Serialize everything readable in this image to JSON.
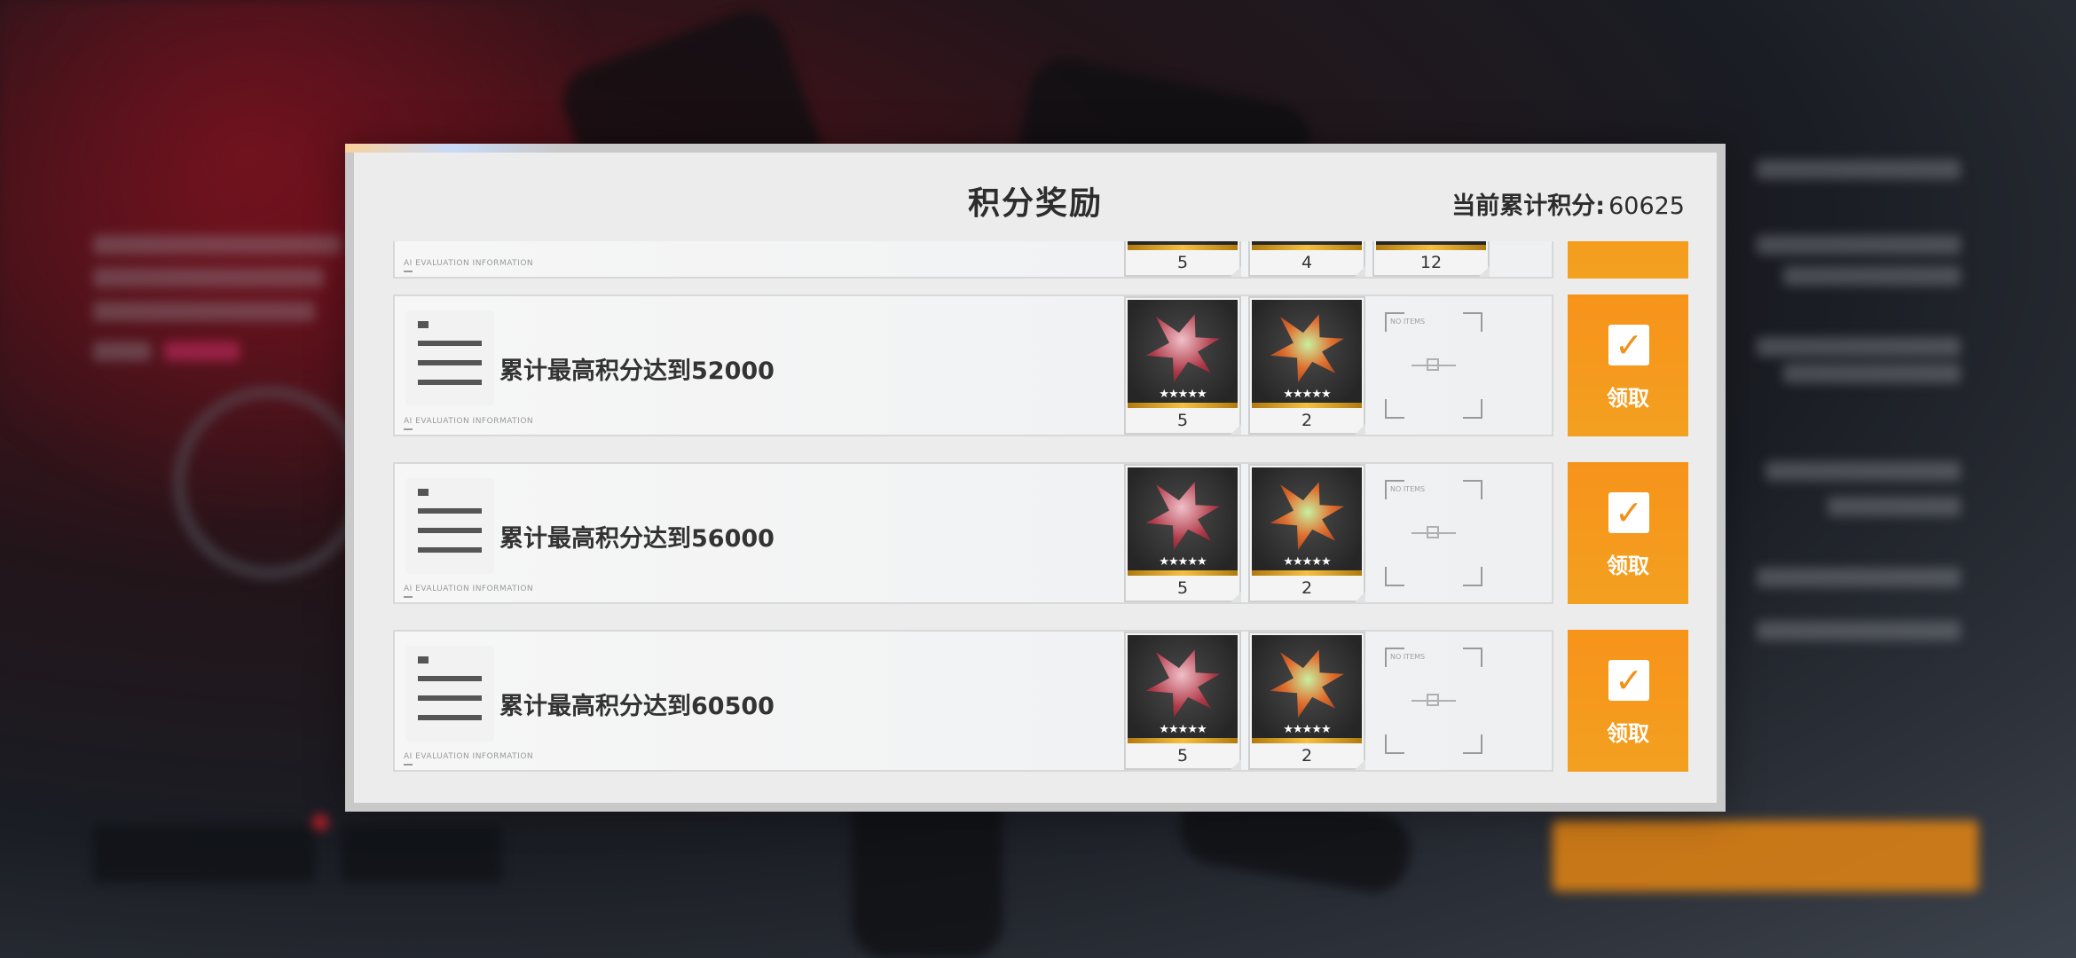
{
  "modal": {
    "title": "积分奖励",
    "score_label": "当前累计积分:",
    "score_value": "60625"
  },
  "eval_tag": "AI EVALUATION INFORMATION",
  "empty_slot_tag": "NO ITEMS",
  "partial_row": {
    "quantities": [
      "5",
      "4",
      "12"
    ]
  },
  "rows": [
    {
      "task": "累计最高积分达到52000",
      "items": [
        {
          "icon": "red-crystal",
          "stars": "★★★★★",
          "qty": "5"
        },
        {
          "icon": "orange-crystal",
          "stars": "★★★★★",
          "qty": "2"
        }
      ],
      "claim": "领取"
    },
    {
      "task": "累计最高积分达到56000",
      "items": [
        {
          "icon": "red-crystal",
          "stars": "★★★★★",
          "qty": "5"
        },
        {
          "icon": "orange-crystal",
          "stars": "★★★★★",
          "qty": "2"
        }
      ],
      "claim": "领取"
    },
    {
      "task": "累计最高积分达到60500",
      "items": [
        {
          "icon": "red-crystal",
          "stars": "★★★★★",
          "qty": "5"
        },
        {
          "icon": "orange-crystal",
          "stars": "★★★★★",
          "qty": "2"
        }
      ],
      "claim": "领取"
    }
  ],
  "colors": {
    "accent": "#f7931a",
    "panel": "#ececec",
    "text": "#2d2d2d"
  }
}
